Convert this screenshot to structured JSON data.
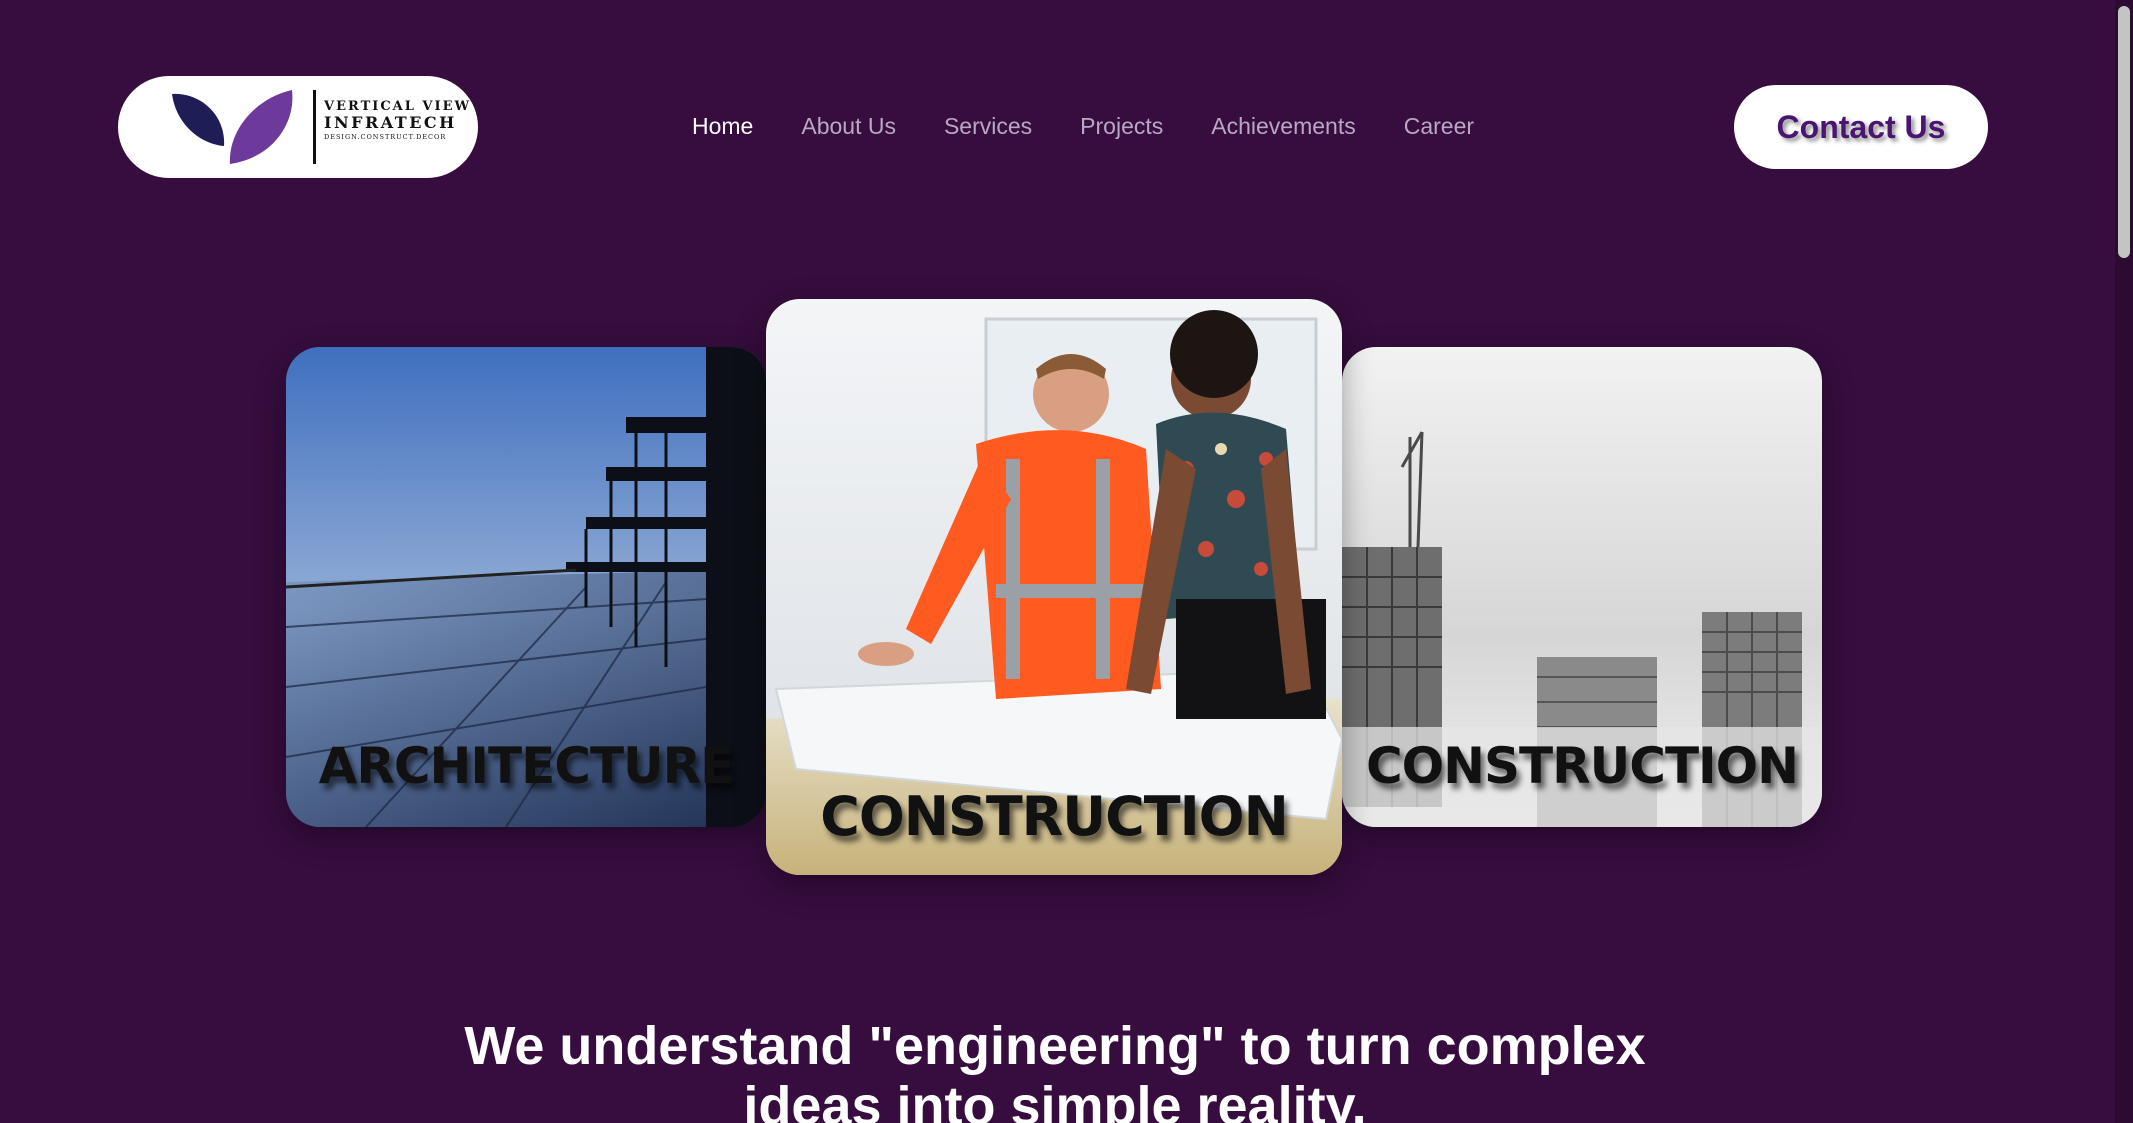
{
  "brand": {
    "line1": "VERTICAL VIEW",
    "line2": "INFRATECH",
    "line3": "DESIGN.CONSTRUCT.DECOR"
  },
  "nav": {
    "items": [
      "Home",
      "About Us",
      "Services",
      "Projects",
      "Achievements",
      "Career"
    ],
    "active": "Home"
  },
  "contact_button": "Contact Us",
  "cards": [
    {
      "label": "ARCHITECTURE"
    },
    {
      "label": "CONSTRUCTION"
    },
    {
      "label": "CONSTRUCTION"
    }
  ],
  "tagline": {
    "line1": "We understand \"engineering\" to turn complex",
    "line2": "ideas into simple reality."
  },
  "colors": {
    "background": "#360d3e",
    "nav_text": "#b9a7c4",
    "nav_active": "#ffffff",
    "contact_text": "#4a1570"
  }
}
